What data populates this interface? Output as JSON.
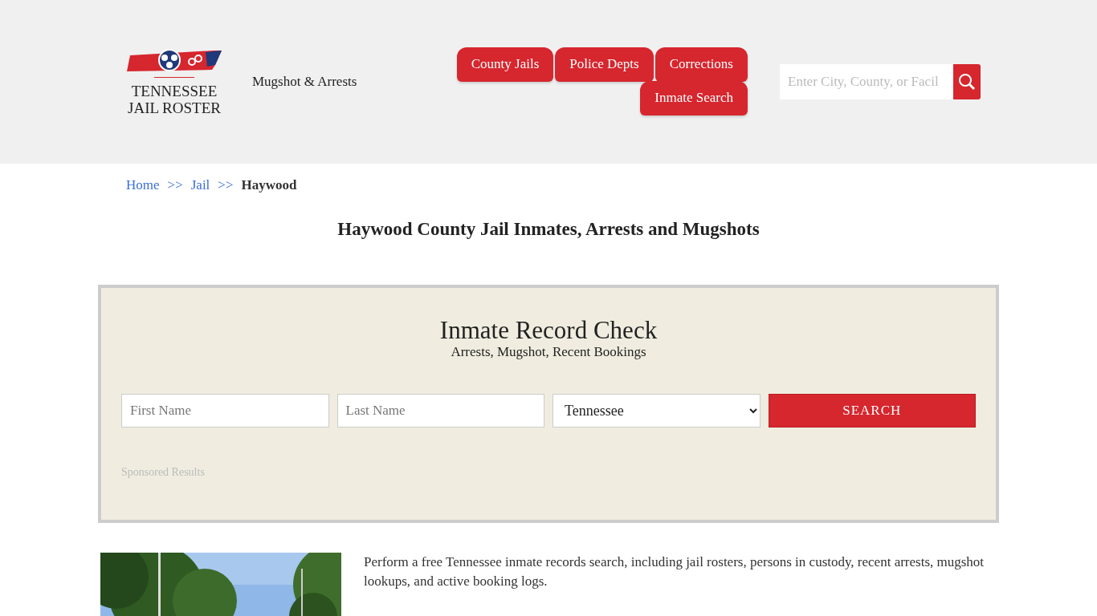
{
  "header": {
    "logo": {
      "line_1": "TENNESSEE",
      "line_2": "JAIL ROSTER"
    },
    "tagline": "Mugshot & Arrests",
    "nav": [
      {
        "label": "County Jails"
      },
      {
        "label": "Police Depts"
      },
      {
        "label": "Corrections"
      },
      {
        "label": "Inmate Search"
      }
    ],
    "search": {
      "placeholder": "Enter City, County, or Facil"
    }
  },
  "breadcrumb": [
    {
      "label": "Home",
      "kind": "link"
    },
    {
      "label": ">>",
      "kind": "sep"
    },
    {
      "label": "Jail",
      "kind": "link"
    },
    {
      "label": ">>",
      "kind": "sep"
    },
    {
      "label": "Haywood",
      "kind": "current"
    }
  ],
  "page_title": "Haywood County Jail Inmates, Arrests and Mugshots",
  "record_check": {
    "title": "Inmate Record Check",
    "subtitle": "Arrests, Mugshot, Recent Bookings",
    "first_name": {
      "placeholder": "First Name"
    },
    "last_name": {
      "placeholder": "Last Name"
    },
    "state": {
      "value": "Tennessee"
    },
    "button": "SEARCH",
    "sponsored": "Sponsored Results"
  },
  "intro": {
    "paragraph": "Perform a free Tennessee inmate records search, including jail rosters, persons in custody, recent arrests, mugshot lookups, and active booking logs."
  }
}
